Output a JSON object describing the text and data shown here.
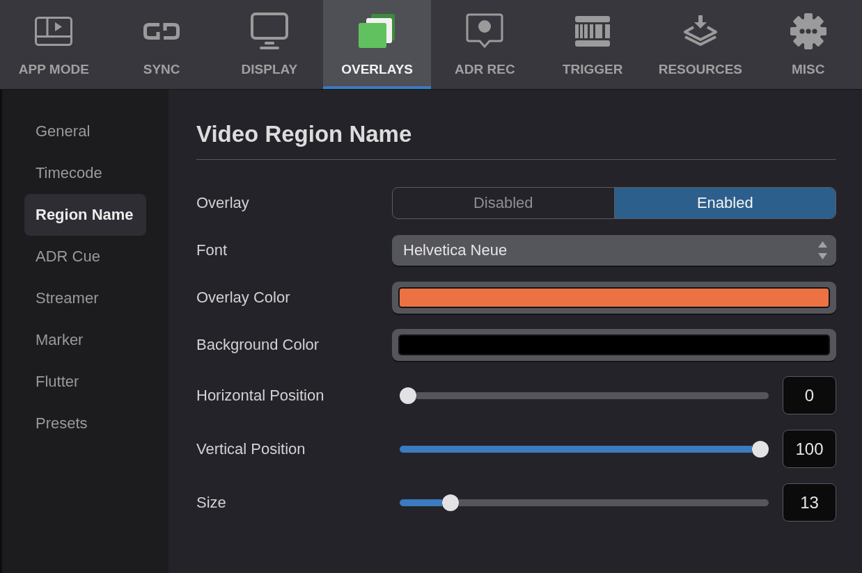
{
  "tabs": [
    {
      "label": "APP MODE",
      "selected": false
    },
    {
      "label": "SYNC",
      "selected": false
    },
    {
      "label": "DISPLAY",
      "selected": false
    },
    {
      "label": "OVERLAYS",
      "selected": true
    },
    {
      "label": "ADR REC",
      "selected": false
    },
    {
      "label": "TRIGGER",
      "selected": false
    },
    {
      "label": "RESOURCES",
      "selected": false
    },
    {
      "label": "MISC",
      "selected": false
    }
  ],
  "sidebar": {
    "items": [
      {
        "label": "General",
        "selected": false
      },
      {
        "label": "Timecode",
        "selected": false
      },
      {
        "label": "Region Name",
        "selected": true
      },
      {
        "label": "ADR Cue",
        "selected": false
      },
      {
        "label": "Streamer",
        "selected": false
      },
      {
        "label": "Marker",
        "selected": false
      },
      {
        "label": "Flutter",
        "selected": false
      },
      {
        "label": "Presets",
        "selected": false
      }
    ]
  },
  "panel": {
    "title": "Video Region Name",
    "rows": [
      {
        "kind": "segmented",
        "label": "Overlay",
        "options": [
          {
            "label": "Disabled",
            "selected": false
          },
          {
            "label": "Enabled",
            "selected": true
          }
        ]
      },
      {
        "kind": "select",
        "label": "Font",
        "value": "Helvetica Neue"
      },
      {
        "kind": "color",
        "label": "Overlay Color",
        "color": "#ed7243"
      },
      {
        "kind": "color",
        "label": "Background Color",
        "color": "#000000"
      },
      {
        "kind": "slider",
        "label": "Horizontal Position",
        "level": 0,
        "value": "0"
      },
      {
        "kind": "slider",
        "label": "Vertical Position",
        "level": 1,
        "value": "100"
      },
      {
        "kind": "slider",
        "label": "Size",
        "level": 0.12,
        "value": "13"
      }
    ]
  }
}
